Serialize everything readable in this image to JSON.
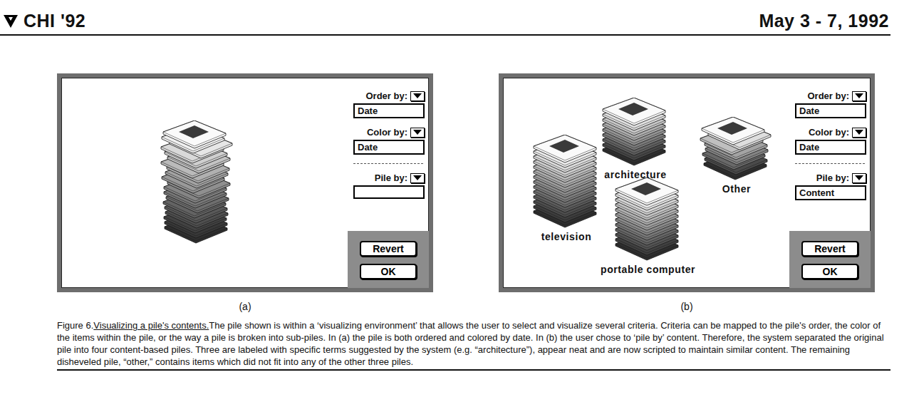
{
  "header": {
    "conference": "CHI '92",
    "dates": "May 3 - 7, 1992"
  },
  "panels": [
    {
      "caption": "(a)",
      "controls": [
        {
          "label": "Order by:",
          "value": "Date"
        },
        {
          "label": "Color by:",
          "value": "Date"
        },
        {
          "label": "Pile by:",
          "value": ""
        }
      ],
      "buttons": [
        "Revert",
        "OK"
      ],
      "piles": [
        {
          "label": "",
          "neat": false,
          "sheets": 20
        }
      ]
    },
    {
      "caption": "(b)",
      "controls": [
        {
          "label": "Order by:",
          "value": "Date"
        },
        {
          "label": "Color by:",
          "value": "Date"
        },
        {
          "label": "Pile by:",
          "value": "Content"
        }
      ],
      "buttons": [
        "Revert",
        "OK"
      ],
      "piles": [
        {
          "label": "television",
          "neat": true,
          "sheets": 14
        },
        {
          "label": "architecture",
          "neat": true,
          "sheets": 9
        },
        {
          "label": "portable computer",
          "neat": true,
          "sheets": 12
        },
        {
          "label": "Other",
          "neat": false,
          "sheets": 8
        }
      ]
    }
  ],
  "figure": {
    "number": "Figure 6.",
    "title": "Visualizing a pile's contents.",
    "text": "The pile shown is within a ‘visualizing environment’ that allows the user to select and visualize several criteria. Criteria can be mapped to the pile's order, the color of the items within the pile, or the way a pile is broken into sub-piles. In (a) the pile is both ordered and colored by date. In (b) the user chose to ‘pile by’ content. Therefore, the system separated the original pile into four content-based piles. Three are labeled with specific terms suggested by the system (e.g. “architecture”), appear neat and are now scripted to maintain similar content. The remaining disheveled pile, “other,” contains items which did not fit into any of the other three piles."
  }
}
